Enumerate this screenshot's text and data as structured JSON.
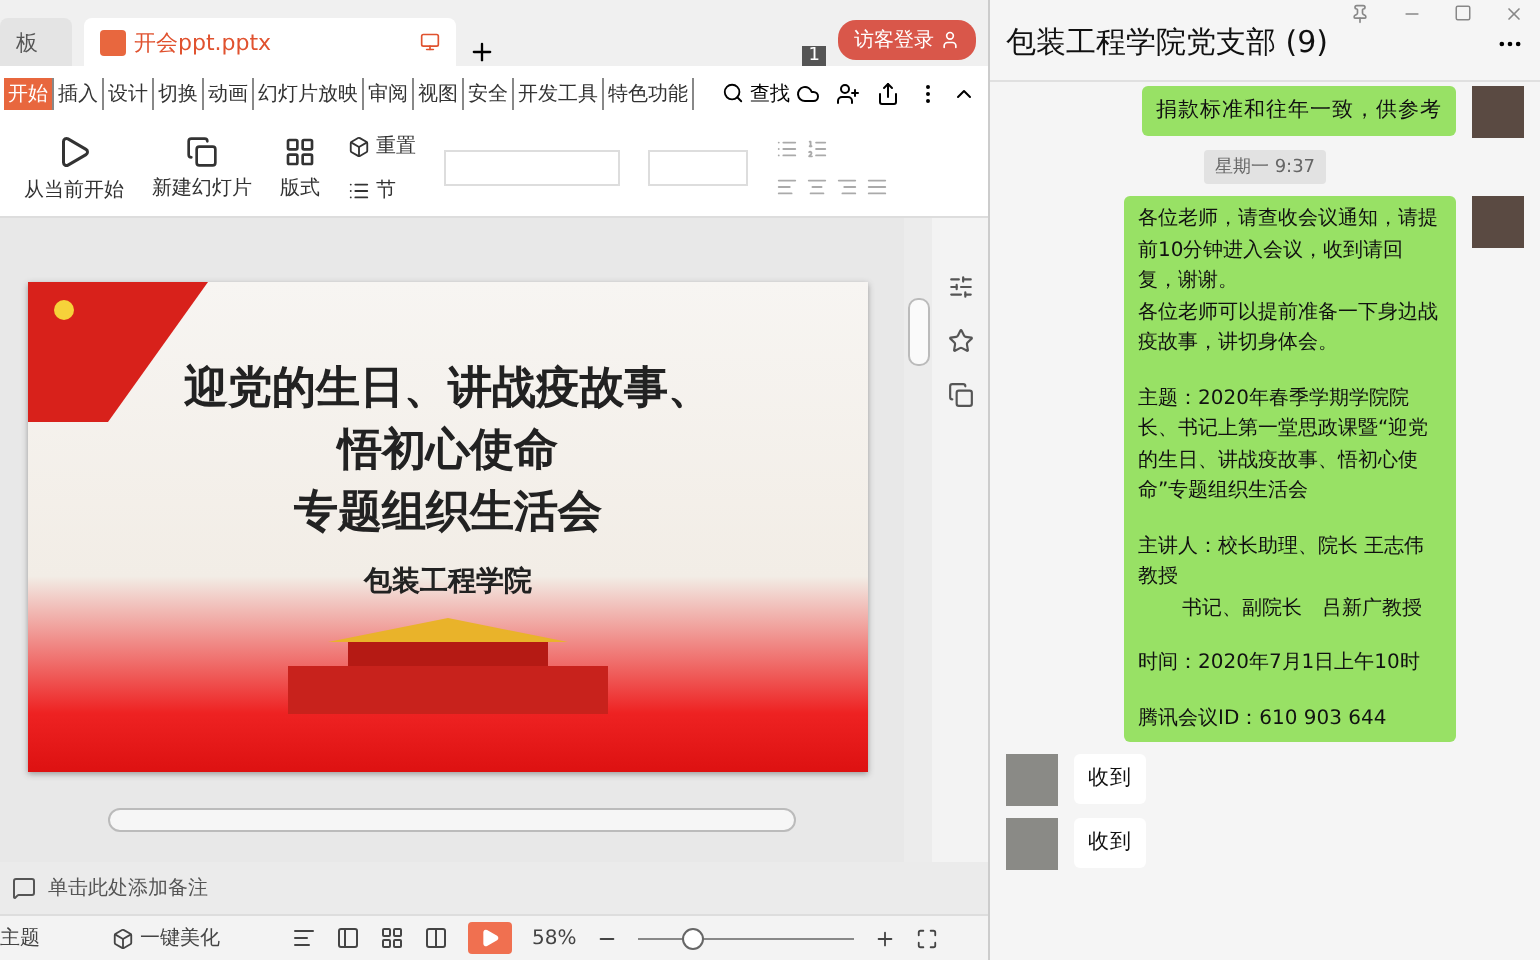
{
  "editor": {
    "tabs": [
      {
        "label": "板",
        "selected": false
      },
      {
        "label": "开会ppt.pptx",
        "selected": true
      }
    ],
    "window_count": "1",
    "login": "访客登录",
    "menu": [
      {
        "label": "开始",
        "selected": true
      },
      {
        "label": "插入",
        "selected": false
      },
      {
        "label": "设计",
        "selected": false
      },
      {
        "label": "切换",
        "selected": false
      },
      {
        "label": "动画",
        "selected": false
      },
      {
        "label": "幻灯片放映",
        "selected": false
      },
      {
        "label": "审阅",
        "selected": false
      },
      {
        "label": "视图",
        "selected": false
      },
      {
        "label": "安全",
        "selected": false
      },
      {
        "label": "开发工具",
        "selected": false
      },
      {
        "label": "特色功能",
        "selected": false
      }
    ],
    "search": "查找",
    "ribbon": {
      "play_from_current": "从当前开始",
      "new_slide": "新建幻灯片",
      "layout": "版式",
      "reset": "重置",
      "section": "节"
    },
    "slide": {
      "title_lines": [
        "迎党的生日、讲战疫故事、",
        "悟初心使命",
        "专题组织生活会"
      ],
      "subtitle": "包装工程学院"
    },
    "notes_placeholder": "单击此处添加备注",
    "status_bar": {
      "theme": "主题",
      "beautify": "一键美化",
      "zoom": "58%",
      "zoom_slider": {
        "level": 0.25
      }
    }
  },
  "chat": {
    "title": "包装工程学院党支部 (9)",
    "messages": [
      {
        "kind": "sent",
        "text": "捐款标准和往年一致，供参考"
      },
      {
        "kind": "time",
        "text": "星期一 9:37"
      },
      {
        "kind": "sent_long",
        "paragraphs": [
          [
            "各位老师，请查收会议通知，请提前10分钟进入会议，收到请回复，谢谢。",
            "各位老师可以提前准备一下身边战疫故事，讲切身体会。"
          ],
          [
            "主题：2020年春季学期学院院长、书记上第一堂思政课暨“迎党的生日、讲战疫故事、悟初心使命”专题组织生活会"
          ],
          [
            "主讲人：校长助理、院长 王志伟教授",
            "书记、副院长　吕新广教授"
          ],
          [
            "时间：2020年7月1日上午10时"
          ],
          [
            "腾讯会议ID：610 903 644"
          ]
        ]
      },
      {
        "kind": "received",
        "text": "收到"
      },
      {
        "kind": "received",
        "text": "收到"
      }
    ]
  }
}
